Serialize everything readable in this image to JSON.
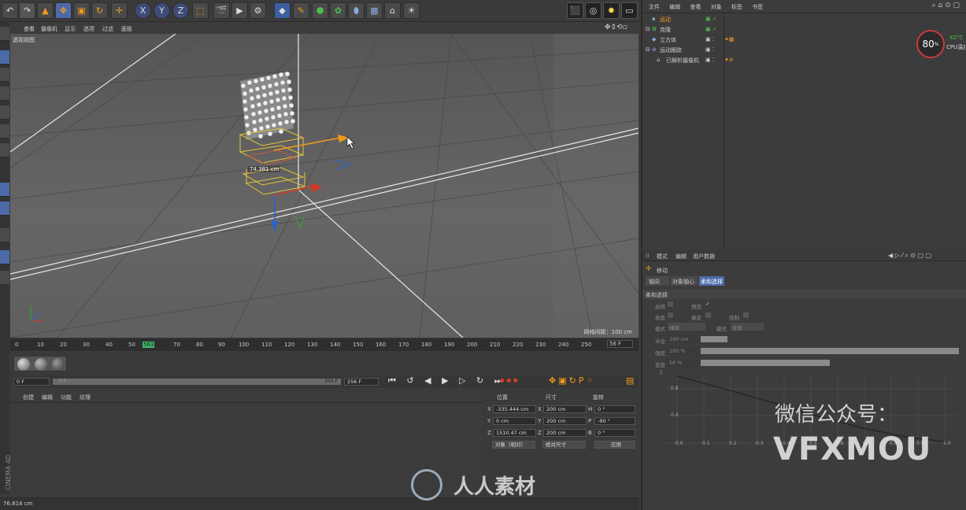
{
  "viewport_label": "透视视图",
  "viewport_menu": [
    "查看",
    "摄像机",
    "显示",
    "选项",
    "过滤",
    "面板"
  ],
  "grid_spacing": "网格间距：100 cm",
  "measure_label": "74.381 cm",
  "timeline": {
    "ticks": [
      "0",
      "10",
      "20",
      "30",
      "40",
      "50",
      "563",
      "70",
      "80",
      "90",
      "100",
      "110",
      "120",
      "130",
      "140",
      "150",
      "160",
      "170",
      "180",
      "190",
      "200",
      "210",
      "220",
      "230",
      "240",
      "250"
    ],
    "end_frame": "56 F",
    "current_frame": "0 F",
    "range_start": "0 F",
    "range_end": "256 F",
    "max_frame": "256 F"
  },
  "bottom_menu": [
    "创建",
    "编辑",
    "功能",
    "纹理"
  ],
  "coords": {
    "headers": [
      "位置",
      "尺寸",
      "旋转"
    ],
    "rows": [
      {
        "axis": "X",
        "pos": "-335.444 cm",
        "size_axis": "X",
        "size": "200 cm",
        "rot_axis": "H",
        "rot": "0 °"
      },
      {
        "axis": "Y",
        "pos": "0 cm",
        "size_axis": "Y",
        "size": "200 cm",
        "rot_axis": "P",
        "rot": "-90 °"
      },
      {
        "axis": "Z",
        "pos": "1510.47 cm",
        "size_axis": "Z",
        "size": "200 cm",
        "rot_axis": "B",
        "rot": "0 °"
      }
    ],
    "mode": "对象（相对）",
    "size_mode": "绝对尺寸",
    "apply": "应用"
  },
  "status_text": "76.814 cm",
  "object_manager": {
    "menu": [
      "文件",
      "编辑",
      "查看",
      "对象",
      "标签",
      "书签"
    ],
    "objects": [
      "运动",
      "克隆",
      "立方体",
      "运动跟踪",
      "已解析摄像机"
    ]
  },
  "cpu": {
    "value": "80",
    "unit": "%",
    "temp": "42°C",
    "label": "CPU温度"
  },
  "attr": {
    "menu": [
      "模式",
      "编辑",
      "用户数据"
    ],
    "title": "移动",
    "tabs": [
      "轴向",
      "对象轴心",
      "柔和选择"
    ],
    "section": "柔和选择",
    "enable": "启用",
    "preview": "预览",
    "surface": "表面",
    "rubber": "橡皮",
    "restrict": "限制",
    "type_label": "模式",
    "type_value": "球状",
    "mode_label": "模式",
    "mode_value": "全部",
    "radius": "半径",
    "radius_value": "100 cm",
    "strength": "强度",
    "strength_value": "100 %",
    "width": "宽度",
    "width_value": "50 %",
    "graph_y": [
      "1",
      "0.8",
      "0.4"
    ],
    "graph_x": [
      "0.0",
      "0.1",
      "0.2",
      "0.3",
      "0.4",
      "0.5",
      "0.6",
      "0.7",
      "0.8",
      "0.9",
      "1.0"
    ]
  },
  "watermark": {
    "line1": "微信公众号：",
    "line2": "VFXMOU",
    "logo_text": "人人素材"
  },
  "side_text": "CINEMA 4D"
}
